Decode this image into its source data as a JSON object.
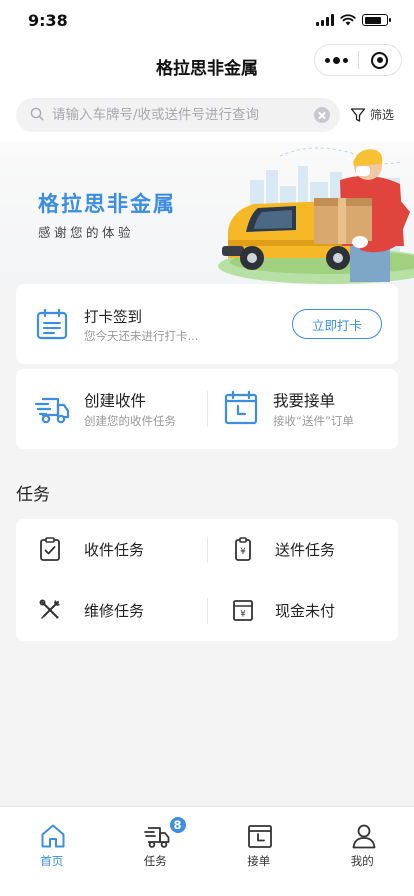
{
  "status_bar": {
    "time": "9:38"
  },
  "nav": {
    "title": "格拉思非金属"
  },
  "search": {
    "placeholder": "请输入车牌号/收或送件号进行查询",
    "filter_label": "筛选"
  },
  "banner": {
    "title": "格拉思非金属",
    "subtitle": "感谢您的体验"
  },
  "checkin": {
    "title": "打卡签到",
    "subtitle": "您今天还未进行打卡...",
    "button": "立即打卡"
  },
  "actions": [
    {
      "title": "创建收件",
      "subtitle": "创建您的收件任务",
      "icon": "truck-lines-icon"
    },
    {
      "title": "我要接单",
      "subtitle": "接收“送件”订单",
      "icon": "calendar-clock-icon"
    }
  ],
  "section": {
    "title": "任务"
  },
  "tasks": [
    {
      "label": "收件任务",
      "icon": "clipboard-check-icon"
    },
    {
      "label": "送件任务",
      "icon": "clipboard-yen-icon"
    },
    {
      "label": "维修任务",
      "icon": "tools-icon"
    },
    {
      "label": "现金未付",
      "icon": "yen-box-icon"
    }
  ],
  "tabbar": {
    "items": [
      {
        "label": "首页",
        "icon": "home-icon",
        "active": true
      },
      {
        "label": "任务",
        "icon": "truck-icon",
        "badge": "8"
      },
      {
        "label": "接单",
        "icon": "calendar-clock-icon"
      },
      {
        "label": "我的",
        "icon": "user-icon"
      }
    ]
  },
  "colors": {
    "accent": "#3d8de0",
    "text": "#222222",
    "muted": "#999999",
    "background": "#f4f4f5"
  }
}
